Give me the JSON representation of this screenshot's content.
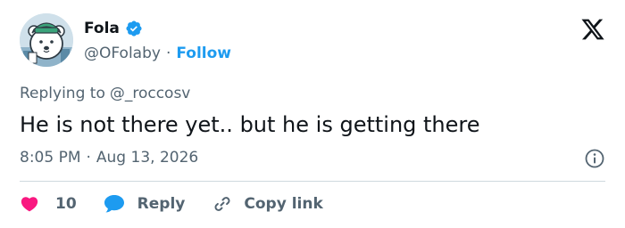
{
  "author": {
    "display_name": "Fola",
    "handle": "@OFolaby",
    "separator": "·",
    "follow_label": "Follow",
    "verified": true,
    "avatar_icon": "polar-bear-avatar"
  },
  "colors": {
    "brand_blue": "#1d9bf0",
    "text_primary": "#0f1419",
    "text_secondary": "#536471",
    "like_red": "#f91880",
    "divider": "#cfd9de"
  },
  "tweet": {
    "replying_prefix": "Replying to",
    "replying_handle": "@_roccosv",
    "text": "He is not there yet.. but he is getting there",
    "time": "8:05 PM",
    "meta_separator": "·",
    "date": "Aug 13, 2026"
  },
  "actions": {
    "like_count": "10",
    "reply_label": "Reply",
    "copy_link_label": "Copy link"
  },
  "icons": {
    "logo": "x-logo-icon",
    "verified": "verified-badge-icon",
    "info": "info-icon",
    "like": "heart-icon",
    "reply": "speech-bubble-icon",
    "copy": "link-icon"
  }
}
